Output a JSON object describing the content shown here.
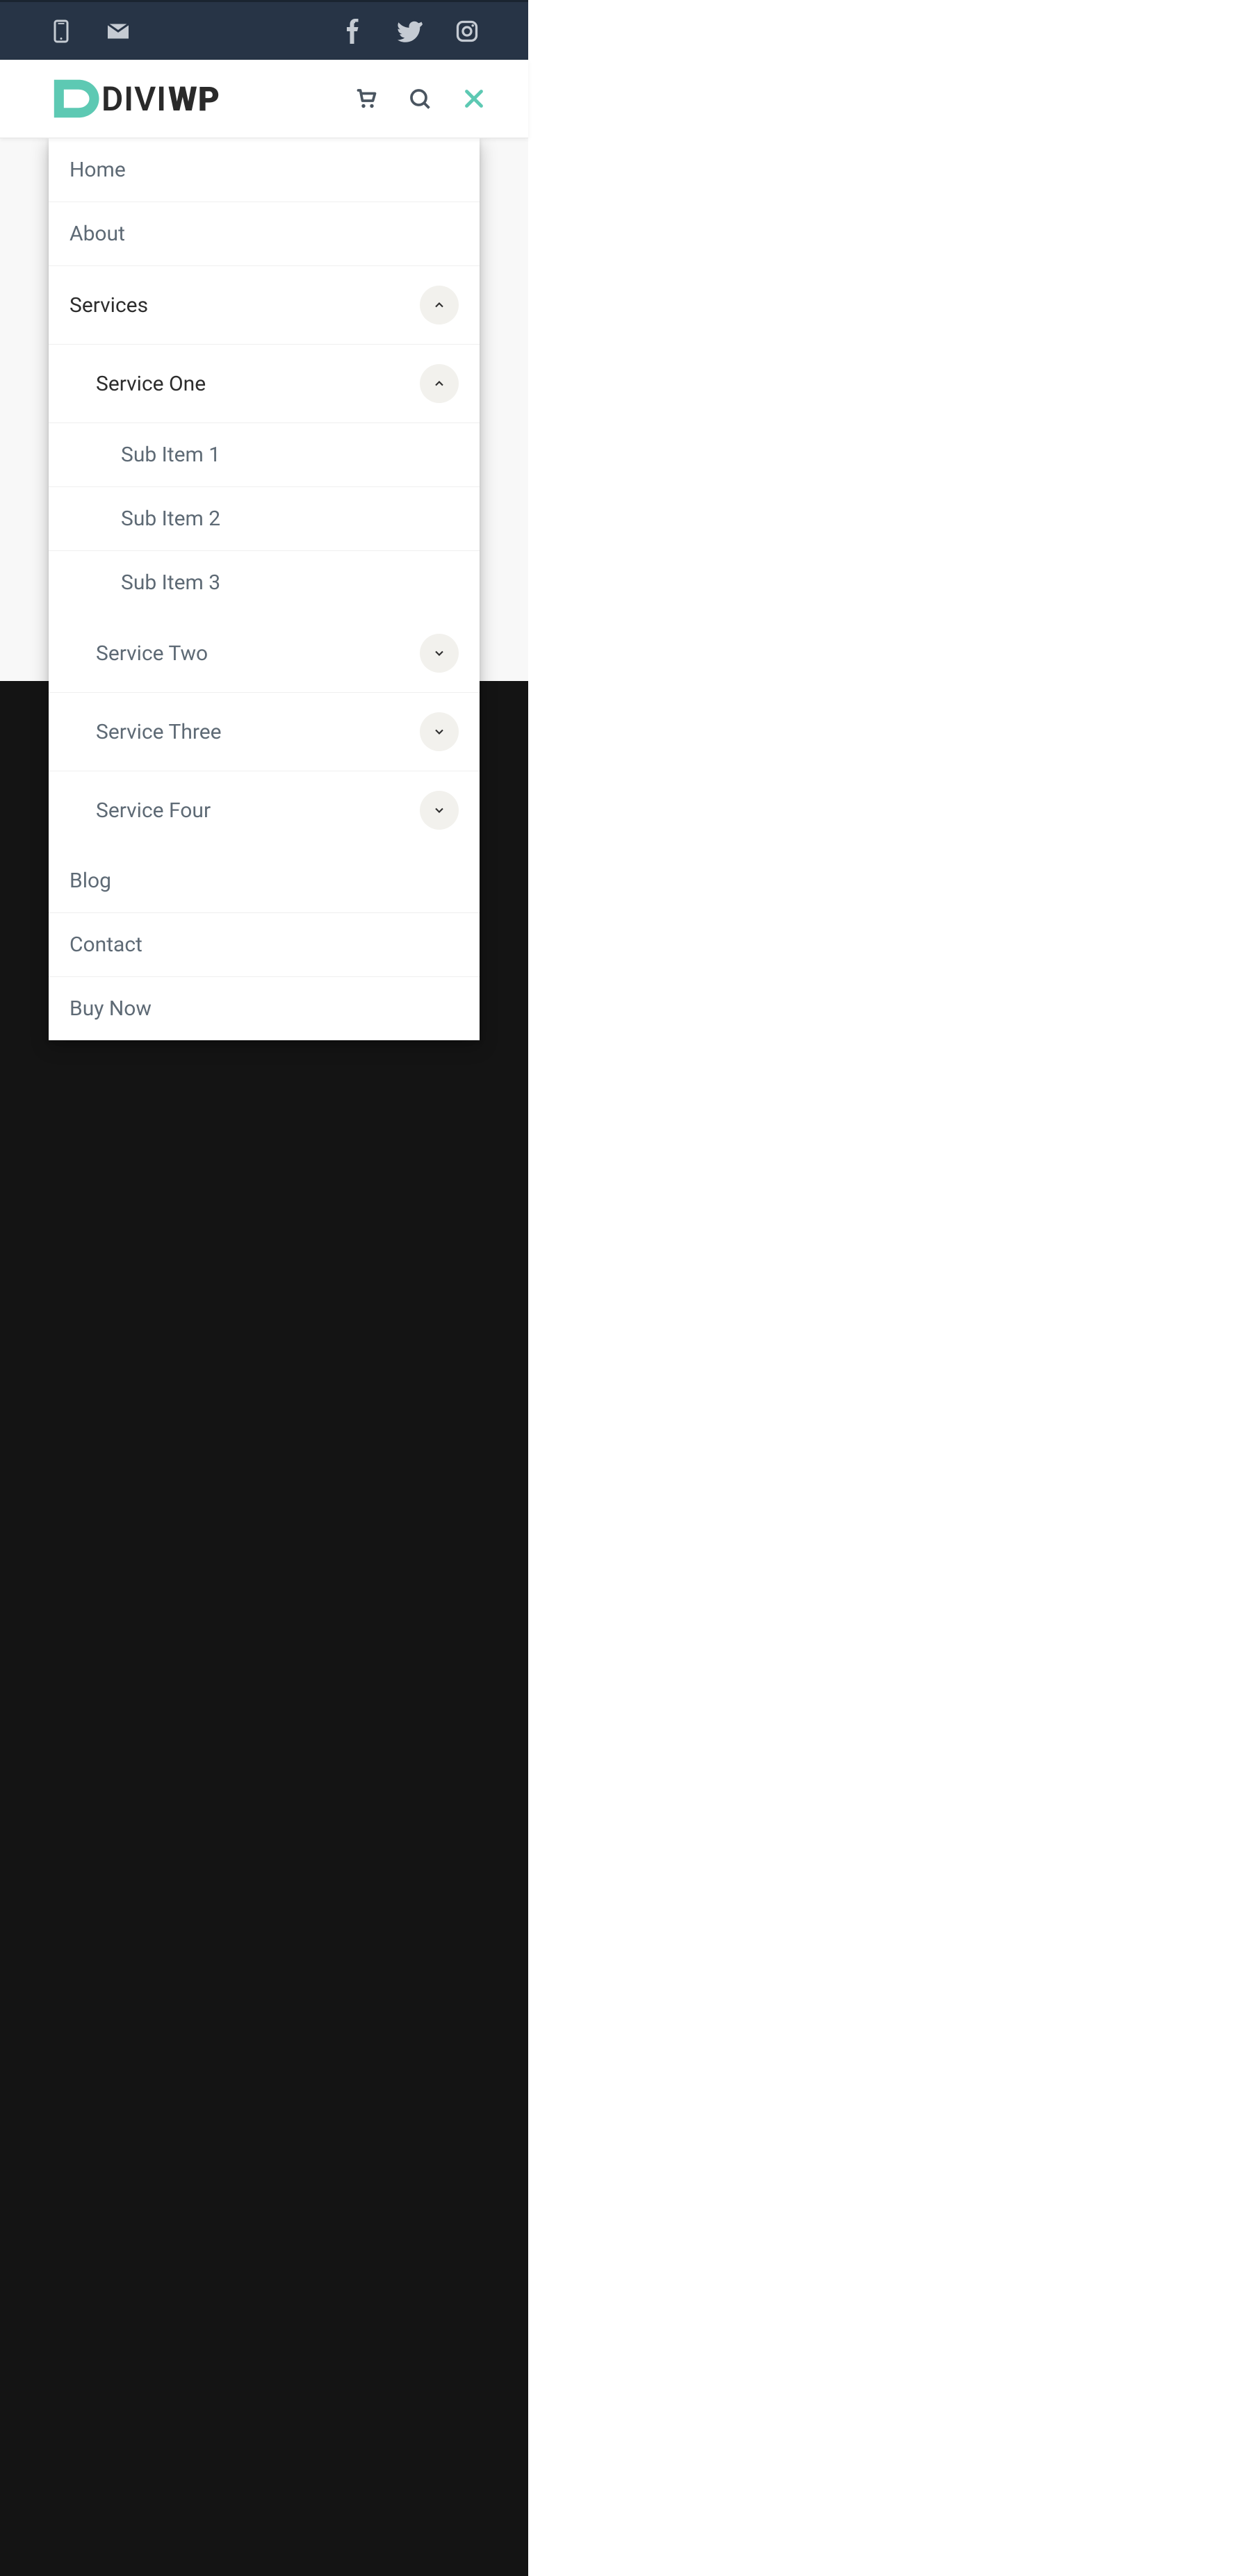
{
  "topbar": {
    "left_icons": [
      "phone-icon",
      "email-icon"
    ],
    "right_icons": [
      "facebook-icon",
      "twitter-icon",
      "instagram-icon"
    ]
  },
  "header": {
    "logo_divi": "DIVI",
    "logo_wp": "WP",
    "icons": [
      "cart-icon",
      "search-icon",
      "close-icon"
    ]
  },
  "menu": {
    "items": [
      {
        "label": "Home",
        "active": false
      },
      {
        "label": "About",
        "active": false
      },
      {
        "label": "Services",
        "active": true,
        "expanded": true,
        "children": [
          {
            "label": "Service One",
            "active": true,
            "expanded": true,
            "children": [
              {
                "label": "Sub Item 1"
              },
              {
                "label": "Sub Item 2"
              },
              {
                "label": "Sub Item 3"
              }
            ]
          },
          {
            "label": "Service Two",
            "expanded": false
          },
          {
            "label": "Service Three",
            "expanded": false
          },
          {
            "label": "Service Four",
            "expanded": false
          }
        ]
      },
      {
        "label": "Blog"
      },
      {
        "label": "Contact"
      },
      {
        "label": "Buy Now"
      }
    ]
  },
  "colors": {
    "accent": "#5dc9b3",
    "topbar_bg": "#273446",
    "text_muted": "#5e6a75",
    "text_active": "#2d2d2d"
  }
}
